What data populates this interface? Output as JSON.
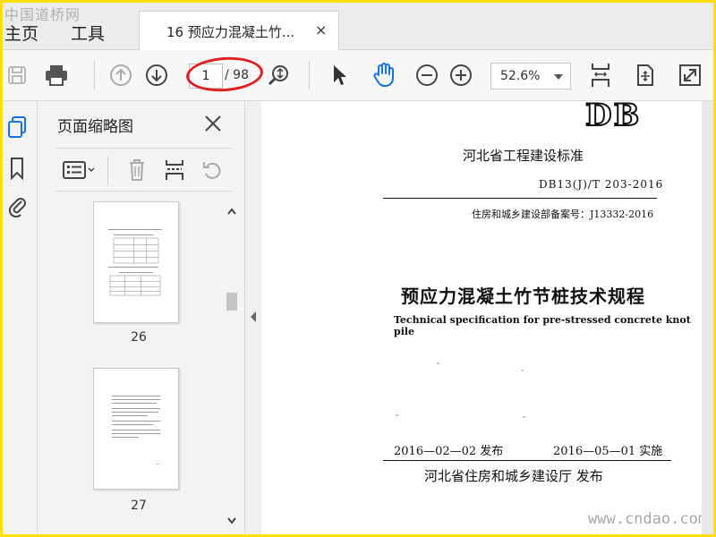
{
  "watermark_top": "中国道桥网",
  "watermark_bottom": "www.cndao.com",
  "nav": {
    "home": "主页",
    "tools": "工具"
  },
  "doc_tab": {
    "title": "16 预应力混凝土竹...",
    "close": "×"
  },
  "toolbar": {
    "page_current": "1",
    "page_total": "/ 98",
    "zoom": "52.6%",
    "icons": [
      "save-icon",
      "print-icon",
      "prev-page-icon",
      "next-page-icon",
      "zoom-page-icon",
      "select-arrow-icon",
      "hand-tool-icon",
      "zoom-out-icon",
      "zoom-in-icon",
      "fit-page-icon",
      "rotate-view-icon",
      "full-screen-icon"
    ]
  },
  "rail": {
    "icons": [
      "thumbnails-icon",
      "bookmark-icon",
      "attachment-icon"
    ]
  },
  "panel": {
    "title": "页面缩略图",
    "thumbnails": [
      {
        "label": "26",
        "progress_hint": 0.5
      },
      {
        "label": "27"
      }
    ]
  },
  "document": {
    "logo": "DB",
    "org": "河北省工程建设标准",
    "code": "DB13(J)/T 203-2016",
    "record_no": "住房和城乡建设部备案号：J13332-2016",
    "title_zh": "预应力混凝土竹节桩技术规程",
    "title_en": "Technical specification for pre-stressed concrete knot pile",
    "issue_date": "2016—02—02 发布",
    "impl_date": "2016—05—01 实施",
    "publisher": "河北省住房和城乡建设厅    发布"
  },
  "colors": {
    "accent_blue": "#1473e6",
    "oval_red": "#e02020",
    "frame_yellow": "#ffe000"
  }
}
